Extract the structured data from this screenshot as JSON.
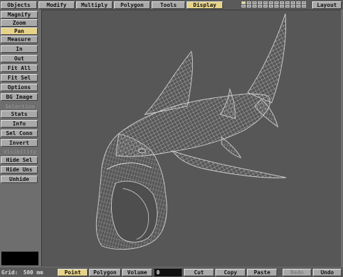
{
  "menu_tabs": [
    {
      "label": "Objects",
      "active": false
    },
    {
      "label": "Modify",
      "active": false
    },
    {
      "label": "Multiply",
      "active": false
    },
    {
      "label": "Polygon",
      "active": false
    },
    {
      "label": "Tools",
      "active": false
    },
    {
      "label": "Display",
      "active": true
    }
  ],
  "layout_label": "Layout",
  "sidebar": {
    "view_buttons": [
      {
        "label": "Magnify",
        "active": false
      },
      {
        "label": "Zoom",
        "active": false
      },
      {
        "label": "Pan",
        "active": true
      },
      {
        "label": "Measure",
        "active": false
      },
      {
        "label": "In",
        "active": false
      },
      {
        "label": "Out",
        "active": false
      },
      {
        "label": "Fit All",
        "active": false
      },
      {
        "label": "Fit Sel",
        "active": false
      },
      {
        "label": "Options",
        "active": false
      },
      {
        "label": "BG Image",
        "active": false
      }
    ],
    "selection_label": "Selection",
    "selection_buttons": [
      {
        "label": "Stats"
      },
      {
        "label": "Info"
      },
      {
        "label": "Sel Conn"
      },
      {
        "label": "Invert"
      }
    ],
    "visibility_label": "Visibility",
    "visibility_buttons": [
      {
        "label": "Hide Sel"
      },
      {
        "label": "Hide Uns"
      },
      {
        "label": "Unhide"
      }
    ]
  },
  "bottom": {
    "grid_label": "Grid:",
    "grid_value": "500 mm",
    "modes": [
      {
        "label": "Point",
        "active": true
      },
      {
        "label": "Polygon",
        "active": false
      },
      {
        "label": "Volume",
        "active": false
      }
    ],
    "number_field": "0",
    "edit_buttons": [
      {
        "label": "Cut",
        "disabled": false
      },
      {
        "label": "Copy",
        "disabled": false
      },
      {
        "label": "Paste",
        "disabled": false
      },
      {
        "label": "Redo",
        "disabled": true
      },
      {
        "label": "Undo",
        "disabled": false
      }
    ]
  },
  "viewport": {
    "object_name": "shark-wireframe",
    "wire_color": "#c8c8c8",
    "background_color": "#575757"
  },
  "colors": {
    "button": "#a9a9a9",
    "active": "#e6d289",
    "panel": "#6e6e6e"
  }
}
